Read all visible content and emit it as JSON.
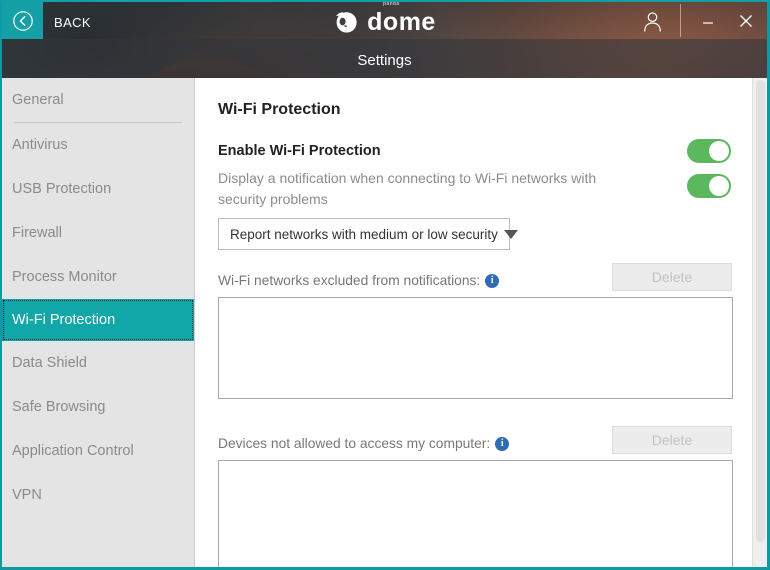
{
  "window": {
    "accent_color": "#0c9ba4",
    "toggle_on_color": "#5cb85c",
    "back_label": "BACK",
    "back_icon": "chevron-left-circle-icon",
    "account_icon": "user-icon",
    "minimize_label": "–",
    "close_label": "✕",
    "settings_title": "Settings"
  },
  "logo": {
    "brand_super": "panda",
    "brand_word": "dome",
    "mark_icon": "panda-logo-icon"
  },
  "sidebar": {
    "items": [
      {
        "label": "General",
        "selected": false
      },
      {
        "label": "Antivirus",
        "selected": false
      },
      {
        "label": "USB Protection",
        "selected": false
      },
      {
        "label": "Firewall",
        "selected": false
      },
      {
        "label": "Process Monitor",
        "selected": false
      },
      {
        "label": "Wi-Fi Protection",
        "selected": true
      },
      {
        "label": "Data Shield",
        "selected": false
      },
      {
        "label": "Safe Browsing",
        "selected": false
      },
      {
        "label": "Application Control",
        "selected": false
      },
      {
        "label": "VPN",
        "selected": false
      }
    ]
  },
  "main": {
    "page_title": "Wi-Fi Protection",
    "enable_label": "Enable Wi-Fi Protection",
    "enable_toggle_state": "on",
    "notify_label": "Display a notification when connecting to Wi-Fi networks with security problems",
    "notify_toggle_state": "on",
    "dropdown": {
      "selected": "Report networks with medium or low security",
      "caret_icon": "chevron-down-icon"
    },
    "excluded_networks": {
      "label": "Wi-Fi networks excluded from notifications:",
      "info_icon": "info-icon",
      "info_glyph": "i",
      "delete_label": "Delete",
      "delete_enabled": false,
      "items": []
    },
    "blocked_devices": {
      "label": "Devices not allowed to access my computer:",
      "info_icon": "info-icon",
      "info_glyph": "i",
      "delete_label": "Delete",
      "delete_enabled": false,
      "items": []
    }
  }
}
